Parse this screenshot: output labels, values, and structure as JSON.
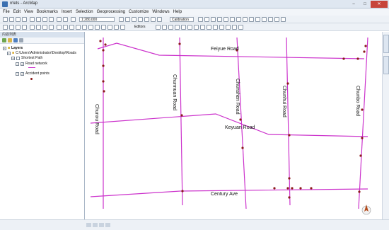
{
  "window": {
    "title": "rrlets - ArcMap"
  },
  "menu": [
    "File",
    "Edit",
    "View",
    "Bookmarks",
    "Insert",
    "Selection",
    "Geoprocessing",
    "Customize",
    "Windows",
    "Help"
  ],
  "toolbar": {
    "scale_value": "1:280,000",
    "calibration_label": "Calibration",
    "editor_label": "Editors"
  },
  "toc": {
    "panel_title": "内容列表",
    "root_label": "Layers",
    "path_label": "C:\\Users\\Administrator\\Desktop\\Roads",
    "group_label": "Shortest Path",
    "layers": [
      {
        "label": "Road network"
      },
      {
        "label": "Accident points"
      }
    ]
  },
  "map": {
    "road_labels": {
      "feiyue": "Feiyue Road",
      "keyuan": "Keyuan Road",
      "century": "Century Ave",
      "chunxu": "Chunxu Road",
      "chunnuan": "Chunnuan Road",
      "chunshen": "Chunshen Road",
      "chunhui": "Chunhui Road",
      "chunbo": "Chunbo Road"
    },
    "road_color": "#cc33cc",
    "point_color": "#8b1a1a"
  },
  "side_tabs": [
    "Catalog",
    "ArcToolbox"
  ]
}
